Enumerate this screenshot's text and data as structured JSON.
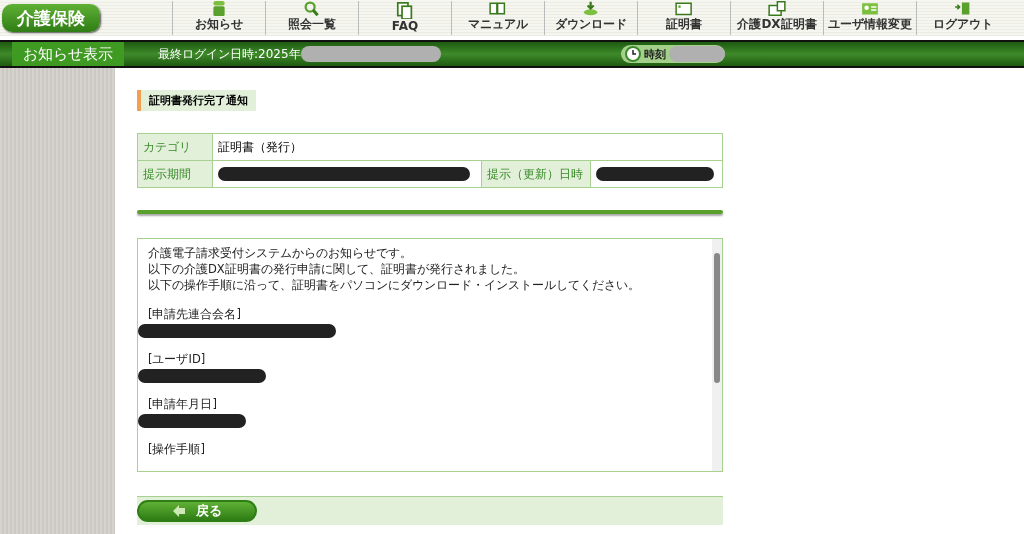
{
  "header": {
    "logo": "介護保険",
    "nav": [
      {
        "label": "お知らせ"
      },
      {
        "label": "照会一覧"
      },
      {
        "label": "FAQ"
      },
      {
        "label": "マニュアル"
      },
      {
        "label": "ダウンロード"
      },
      {
        "label": "証明書"
      },
      {
        "label": "介護DX証明書"
      },
      {
        "label": "ユーザ情報変更"
      },
      {
        "label": "ログアウト"
      }
    ]
  },
  "status_bar": {
    "page_title": "お知らせ表示",
    "last_login": "最終ログイン日時:2025年",
    "last_login_redacted": true,
    "time_label": "時刻",
    "time_redacted": true
  },
  "notice": {
    "title": "証明書発行完了通知",
    "table": [
      {
        "label": "カテゴリ",
        "value": "証明書（発行）",
        "redacted": false
      },
      {
        "label": "提示期間",
        "redacted": true
      },
      {
        "label": "提示（更新）日時",
        "redacted": true
      }
    ],
    "message": {
      "lines": [
        "介護電子請求受付システムからのお知らせです。",
        "以下の介護DX証明書の発行申請に関して、証明書が発行されました。",
        "以下の操作手順に沿って、証明書をパソコンにダウンロード・インストールしてください。"
      ],
      "sections": [
        {
          "heading": "[申請先連合会名]",
          "redacted": true
        },
        {
          "heading": "[ユーザID]",
          "redacted": true
        },
        {
          "heading": "[申請年月日]",
          "redacted": true
        },
        {
          "heading": "[操作手順]",
          "redacted": false
        }
      ]
    }
  },
  "back_button": "戻る"
}
